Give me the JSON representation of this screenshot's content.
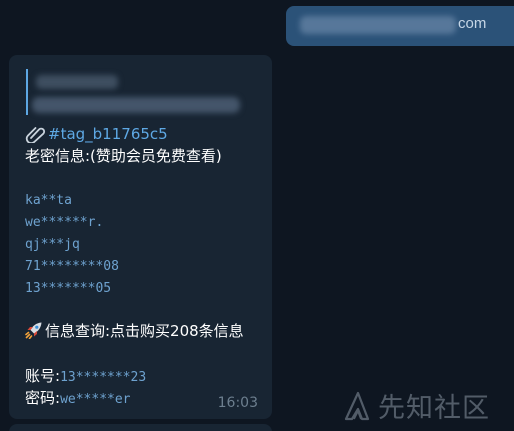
{
  "outgoing": {
    "visible_suffix": "com"
  },
  "message": {
    "tag": "#tag_b11765c5",
    "title": "老密信息:(赞助会员免费查看)",
    "masked_entries": [
      "ka**ta",
      "we******r.",
      "qj***jq",
      "71********08",
      "13*******05"
    ],
    "query_line": "信息查询:点击购买208条信息",
    "account_label": "账号:",
    "account_value": "13*******23",
    "password_label": "密码:",
    "password_value": "we*****er",
    "time": "16:03"
  },
  "icons": {
    "attachment": "paperclip-icon",
    "rocket": "rocket-icon",
    "watermark_logo": "xianzhi-logo-icon"
  },
  "watermark": {
    "text": "先知社区"
  },
  "colors": {
    "background": "#0e1621",
    "incoming_bubble": "#182533",
    "outgoing_bubble": "#2b5278",
    "link": "#5ea8e4",
    "monospace": "#6ea2cf",
    "timestamp": "#6d7f8f"
  }
}
